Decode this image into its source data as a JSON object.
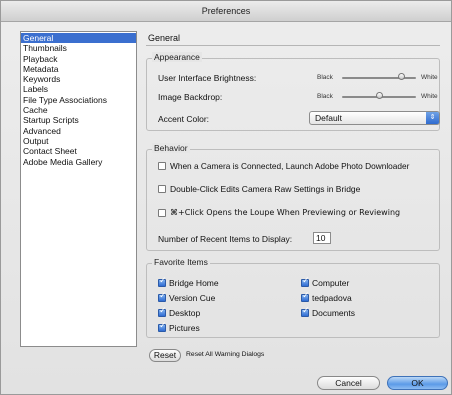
{
  "window": {
    "title": "Preferences"
  },
  "sidebar": {
    "items": [
      {
        "label": "General",
        "selected": true
      },
      {
        "label": "Thumbnails"
      },
      {
        "label": "Playback"
      },
      {
        "label": "Metadata"
      },
      {
        "label": "Keywords"
      },
      {
        "label": "Labels"
      },
      {
        "label": "File Type Associations"
      },
      {
        "label": "Cache"
      },
      {
        "label": "Startup Scripts"
      },
      {
        "label": "Advanced"
      },
      {
        "label": "Output"
      },
      {
        "label": "Contact Sheet"
      },
      {
        "label": "Adobe Media Gallery"
      }
    ]
  },
  "main": {
    "section_title": "General",
    "appearance": {
      "label": "Appearance",
      "brightness_label": "User Interface Brightness:",
      "brightness_min": "Black",
      "brightness_max": "White",
      "brightness_value": 0.8,
      "backdrop_label": "Image Backdrop:",
      "backdrop_min": "Black",
      "backdrop_max": "White",
      "backdrop_value": 0.5,
      "accent_label": "Accent Color:",
      "accent_value": "Default"
    },
    "behavior": {
      "label": "Behavior",
      "opt1": "When a Camera is Connected, Launch Adobe Photo Downloader",
      "opt1_checked": false,
      "opt2": "Double-Click Edits Camera Raw Settings in Bridge",
      "opt2_checked": false,
      "opt3": "⌘+Click Opens the Loupe When Previewing or Reviewing",
      "opt3_checked": false,
      "recent_label": "Number of Recent Items to Display:",
      "recent_value": "10"
    },
    "favorites": {
      "label": "Favorite Items",
      "bridge_home": "Bridge Home",
      "version_cue": "Version Cue",
      "desktop": "Desktop",
      "pictures": "Pictures",
      "computer": "Computer",
      "tedpadova": "tedpadova",
      "documents": "Documents"
    },
    "reset_button": "Reset",
    "reset_warning": "Reset All Warning Dialogs"
  },
  "footer": {
    "cancel": "Cancel",
    "ok": "OK"
  },
  "colors": {
    "selection": "#3b6fcf",
    "accent_blue": "#2f6bd0"
  }
}
